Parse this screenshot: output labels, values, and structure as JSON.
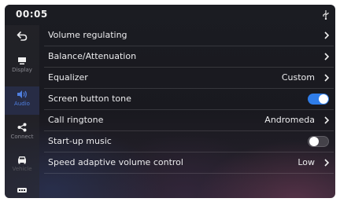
{
  "status": {
    "time": "00:05",
    "usb_icon": "usb-icon"
  },
  "sidebar": {
    "items": [
      {
        "label": "",
        "icon": "back-arrow-icon"
      },
      {
        "label": "Display",
        "icon": "display-icon"
      },
      {
        "label": "Audio",
        "icon": "speaker-icon",
        "active": true
      },
      {
        "label": "Connect",
        "icon": "share-icon"
      },
      {
        "label": "Vehicle",
        "icon": "car-icon"
      },
      {
        "label": "",
        "icon": "more-icon"
      }
    ]
  },
  "settings": {
    "rows": [
      {
        "label": "Volume regulating",
        "value": "",
        "control": "chevron"
      },
      {
        "label": "Balance/Attenuation",
        "value": "",
        "control": "chevron"
      },
      {
        "label": "Equalizer",
        "value": "Custom",
        "control": "chevron"
      },
      {
        "label": "Screen button tone",
        "value": "",
        "control": "toggle",
        "state": "on"
      },
      {
        "label": "Call ringtone",
        "value": "Andromeda",
        "control": "chevron"
      },
      {
        "label": "Start-up music",
        "value": "",
        "control": "toggle",
        "state": "off"
      },
      {
        "label": "Speed adaptive volume control",
        "value": "Low",
        "control": "chevron"
      }
    ]
  },
  "colors": {
    "accent": "#2f7de9",
    "active_label": "#4f7fe0"
  }
}
